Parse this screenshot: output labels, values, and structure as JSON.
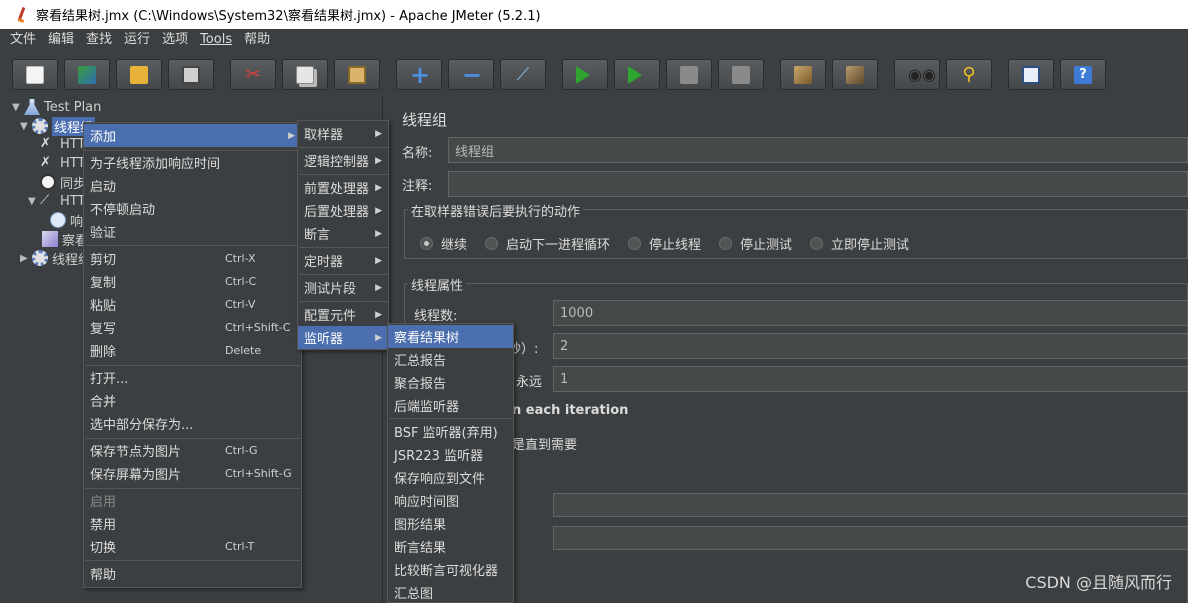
{
  "window": {
    "title": "察看结果树.jmx (C:\\Windows\\System32\\察看结果树.jmx) - Apache JMeter (5.2.1)"
  },
  "menubar": {
    "items": [
      "文件",
      "编辑",
      "查找",
      "运行",
      "选项",
      "Tools",
      "帮助"
    ]
  },
  "toolbar": {
    "icons": [
      "new-icon",
      "templates-icon",
      "open-icon",
      "save-icon",
      "cut-icon",
      "copy-icon",
      "paste-icon",
      "expand-icon",
      "collapse-icon",
      "toggle-icon",
      "start-icon",
      "start-no-pauses-icon",
      "stop-icon",
      "shutdown-icon",
      "clear-icon",
      "clear-all-icon",
      "search-icon",
      "reset-search-icon",
      "function-helper-icon",
      "help-icon"
    ]
  },
  "tree": {
    "items": [
      {
        "label": "Test Plan"
      },
      {
        "label": "线程组"
      },
      {
        "label": "HTT"
      },
      {
        "label": "HTT"
      },
      {
        "label": "同步"
      },
      {
        "label": "HTT"
      },
      {
        "label": "响"
      },
      {
        "label": "察看"
      },
      {
        "label": "线程组"
      }
    ]
  },
  "panel": {
    "title": "线程组",
    "name_label": "名称:",
    "name_value": "线程组",
    "comment_label": "注释:",
    "comment_value": "",
    "error_group_title": "在取样器错误后要执行的动作",
    "error_options": [
      "继续",
      "启动下一进程循环",
      "停止线程",
      "停止测试",
      "立即停止测试"
    ],
    "selected_error_option": "继续",
    "props_group_title": "线程属性",
    "threads_label": "线程数:",
    "threads_value": "1000",
    "rampup_label_fragment": "秒）:",
    "rampup_value": "2",
    "loop_label_fragment": "永远",
    "loop_value": "1",
    "same_user_fragment": "n each iteration",
    "delay_fragment": "是直到需要"
  },
  "context_menu": {
    "items": [
      {
        "label": "添加",
        "submenu": true
      },
      {
        "label": "为子线程添加响应时间"
      },
      {
        "label": "启动"
      },
      {
        "label": "不停顿启动"
      },
      {
        "label": "验证"
      },
      {
        "label": "剪切",
        "accel": "Ctrl-X"
      },
      {
        "label": "复制",
        "accel": "Ctrl-C"
      },
      {
        "label": "粘贴",
        "accel": "Ctrl-V"
      },
      {
        "label": "复写",
        "accel": "Ctrl+Shift-C"
      },
      {
        "label": "删除",
        "accel": "Delete"
      },
      {
        "label": "打开..."
      },
      {
        "label": "合并"
      },
      {
        "label": "选中部分保存为..."
      },
      {
        "label": "保存节点为图片",
        "accel": "Ctrl-G"
      },
      {
        "label": "保存屏幕为图片",
        "accel": "Ctrl+Shift-G"
      },
      {
        "label": "启用"
      },
      {
        "label": "禁用"
      },
      {
        "label": "切换",
        "accel": "Ctrl-T"
      },
      {
        "label": "帮助"
      }
    ]
  },
  "add_submenu": {
    "items": [
      "取样器",
      "逻辑控制器",
      "前置处理器",
      "后置处理器",
      "断言",
      "定时器",
      "测试片段",
      "配置元件",
      "监听器"
    ]
  },
  "listener_submenu": {
    "items": [
      "察看结果树",
      "汇总报告",
      "聚合报告",
      "后端监听器",
      "BSF 监听器(弃用)",
      "JSR223 监听器",
      "保存响应到文件",
      "响应时间图",
      "图形结果",
      "断言结果",
      "比较断言可视化器",
      "汇总图"
    ]
  },
  "watermark": "CSDN @且随风而行"
}
